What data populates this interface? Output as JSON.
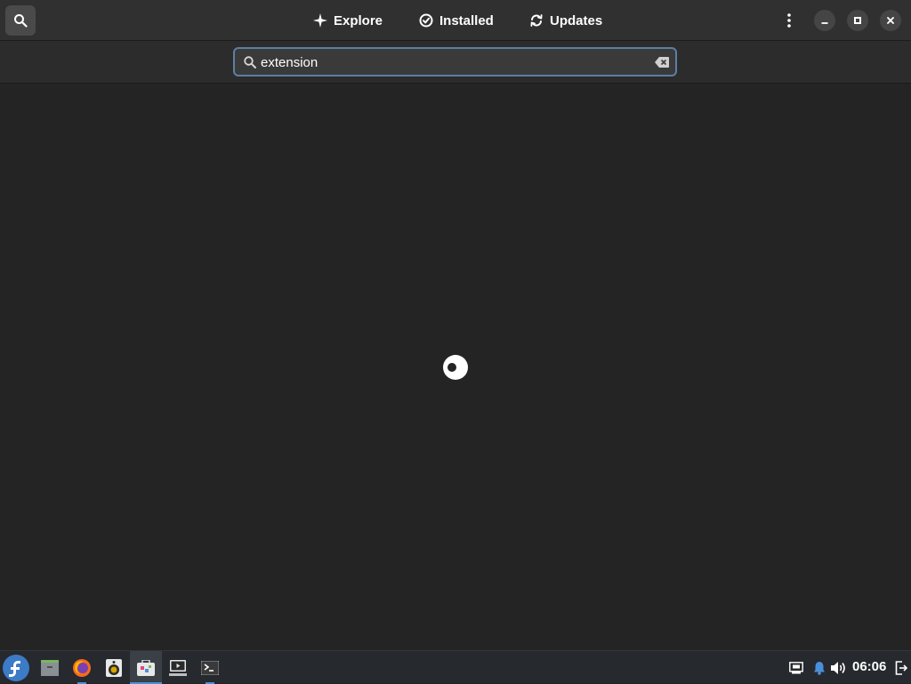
{
  "header": {
    "tabs": [
      {
        "label": "Explore",
        "icon": "sparkle-icon"
      },
      {
        "label": "Installed",
        "icon": "check-circle-icon"
      },
      {
        "label": "Updates",
        "icon": "refresh-icon"
      }
    ]
  },
  "search": {
    "value": "extension",
    "placeholder": ""
  },
  "taskbar": {
    "apps": [
      {
        "name": "fedora-logo",
        "active": false
      },
      {
        "name": "files",
        "active": false
      },
      {
        "name": "firefox",
        "active": false
      },
      {
        "name": "rhythmbox",
        "active": false
      },
      {
        "name": "software",
        "active": true
      },
      {
        "name": "videos",
        "active": false
      },
      {
        "name": "terminal",
        "active": false
      }
    ],
    "clock": "06:06"
  },
  "colors": {
    "window_bg": "#242424",
    "header_bg": "#303030",
    "focus_border": "#5d7fa3",
    "taskbar_bg": "#26292e",
    "accent": "#4a90d9"
  }
}
